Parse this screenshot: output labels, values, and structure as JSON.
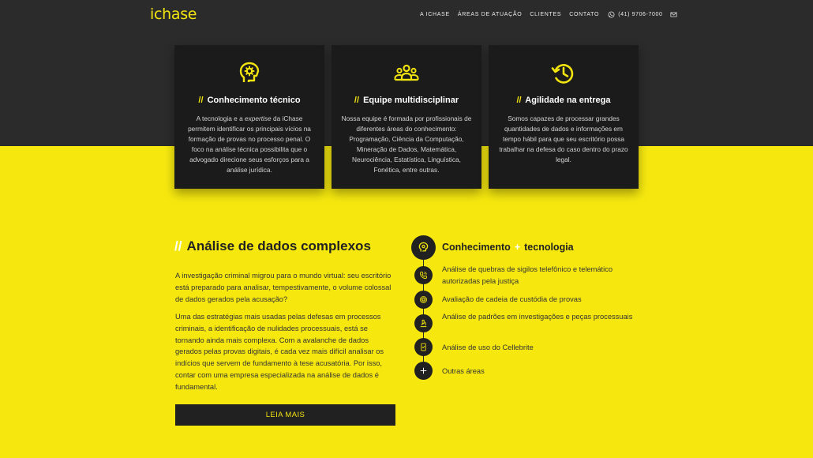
{
  "header": {
    "logo": "ichase",
    "nav": [
      "A ICHASE",
      "ÁREAS DE ATUAÇÃO",
      "CLIENTES",
      "CONTATO"
    ],
    "phone": "(41) 9706-7000",
    "phone_icon": "whatsapp-icon",
    "mail_icon": "mail-icon"
  },
  "cards": [
    {
      "icon": "brain-gear-icon",
      "slash": "//",
      "title": "Conhecimento técnico",
      "text_before": "A tecnologia e a ",
      "text_em": "expertise",
      "text_after": " da iChase permitem identificar os principais vícios na formação de provas no processo penal. O foco na análise técnica possibilita que o advogado direcione seus esforços para a análise jurídica."
    },
    {
      "icon": "team-icon",
      "slash": "//",
      "title": "Equipe multidisciplinar",
      "text": "Nossa equipe é formada por profissionais de diferentes áreas do conhecimento: Programação, Ciência da Computação, Mineração de Dados, Matemática, Neurociência, Estatística, Linguística, Fonética, entre outras."
    },
    {
      "icon": "clock-history-icon",
      "slash": "//",
      "title": "Agilidade na entrega",
      "text": "Somos capazes de processar grandes quantidades de dados e informações em tempo hábil para que seu escritório possa trabalhar na defesa do caso dentro do prazo legal."
    }
  ],
  "analysis": {
    "slash": "//",
    "title": "Análise de dados complexos",
    "p1": "A investigação criminal migrou para o mundo virtual: seu escritório está preparado para analisar, tempestivamente, o volume colossal de dados gerados pela acusação?",
    "p2": "Uma das estratégias mais usadas pelas defesas em processos criminais, a identificação de nulidades processuais, está se tornando ainda mais complexa. Com a avalanche de dados gerados pelas provas digitais, é cada vez mais difícil analisar os indícios que servem de fundamento à tese acusatória. Por isso, contar com uma empresa especializada na análise de dados é fundamental.",
    "button": "LEIA MAIS"
  },
  "timeline": {
    "heading_a": "Conhecimento",
    "plus": "+",
    "heading_b": "tecnologia",
    "items": [
      {
        "icon": "phone-icon",
        "text": "Análise de quebras de sigilos telefônico e telemático autorizadas pela justiça"
      },
      {
        "icon": "fingerprint-icon",
        "text": "Avaliação de cadeia de custódia de provas"
      },
      {
        "icon": "microscope-icon",
        "text": "Análise de padrões em investigações e peças processuais"
      },
      {
        "icon": "mobile-check-icon",
        "text": "Análise de uso do Cellebrite"
      },
      {
        "icon": "plus-icon",
        "text": "Outras áreas"
      }
    ]
  },
  "colors": {
    "accent": "#f6e80f",
    "dark": "#2c2b2b",
    "card": "#1b1b1b"
  }
}
